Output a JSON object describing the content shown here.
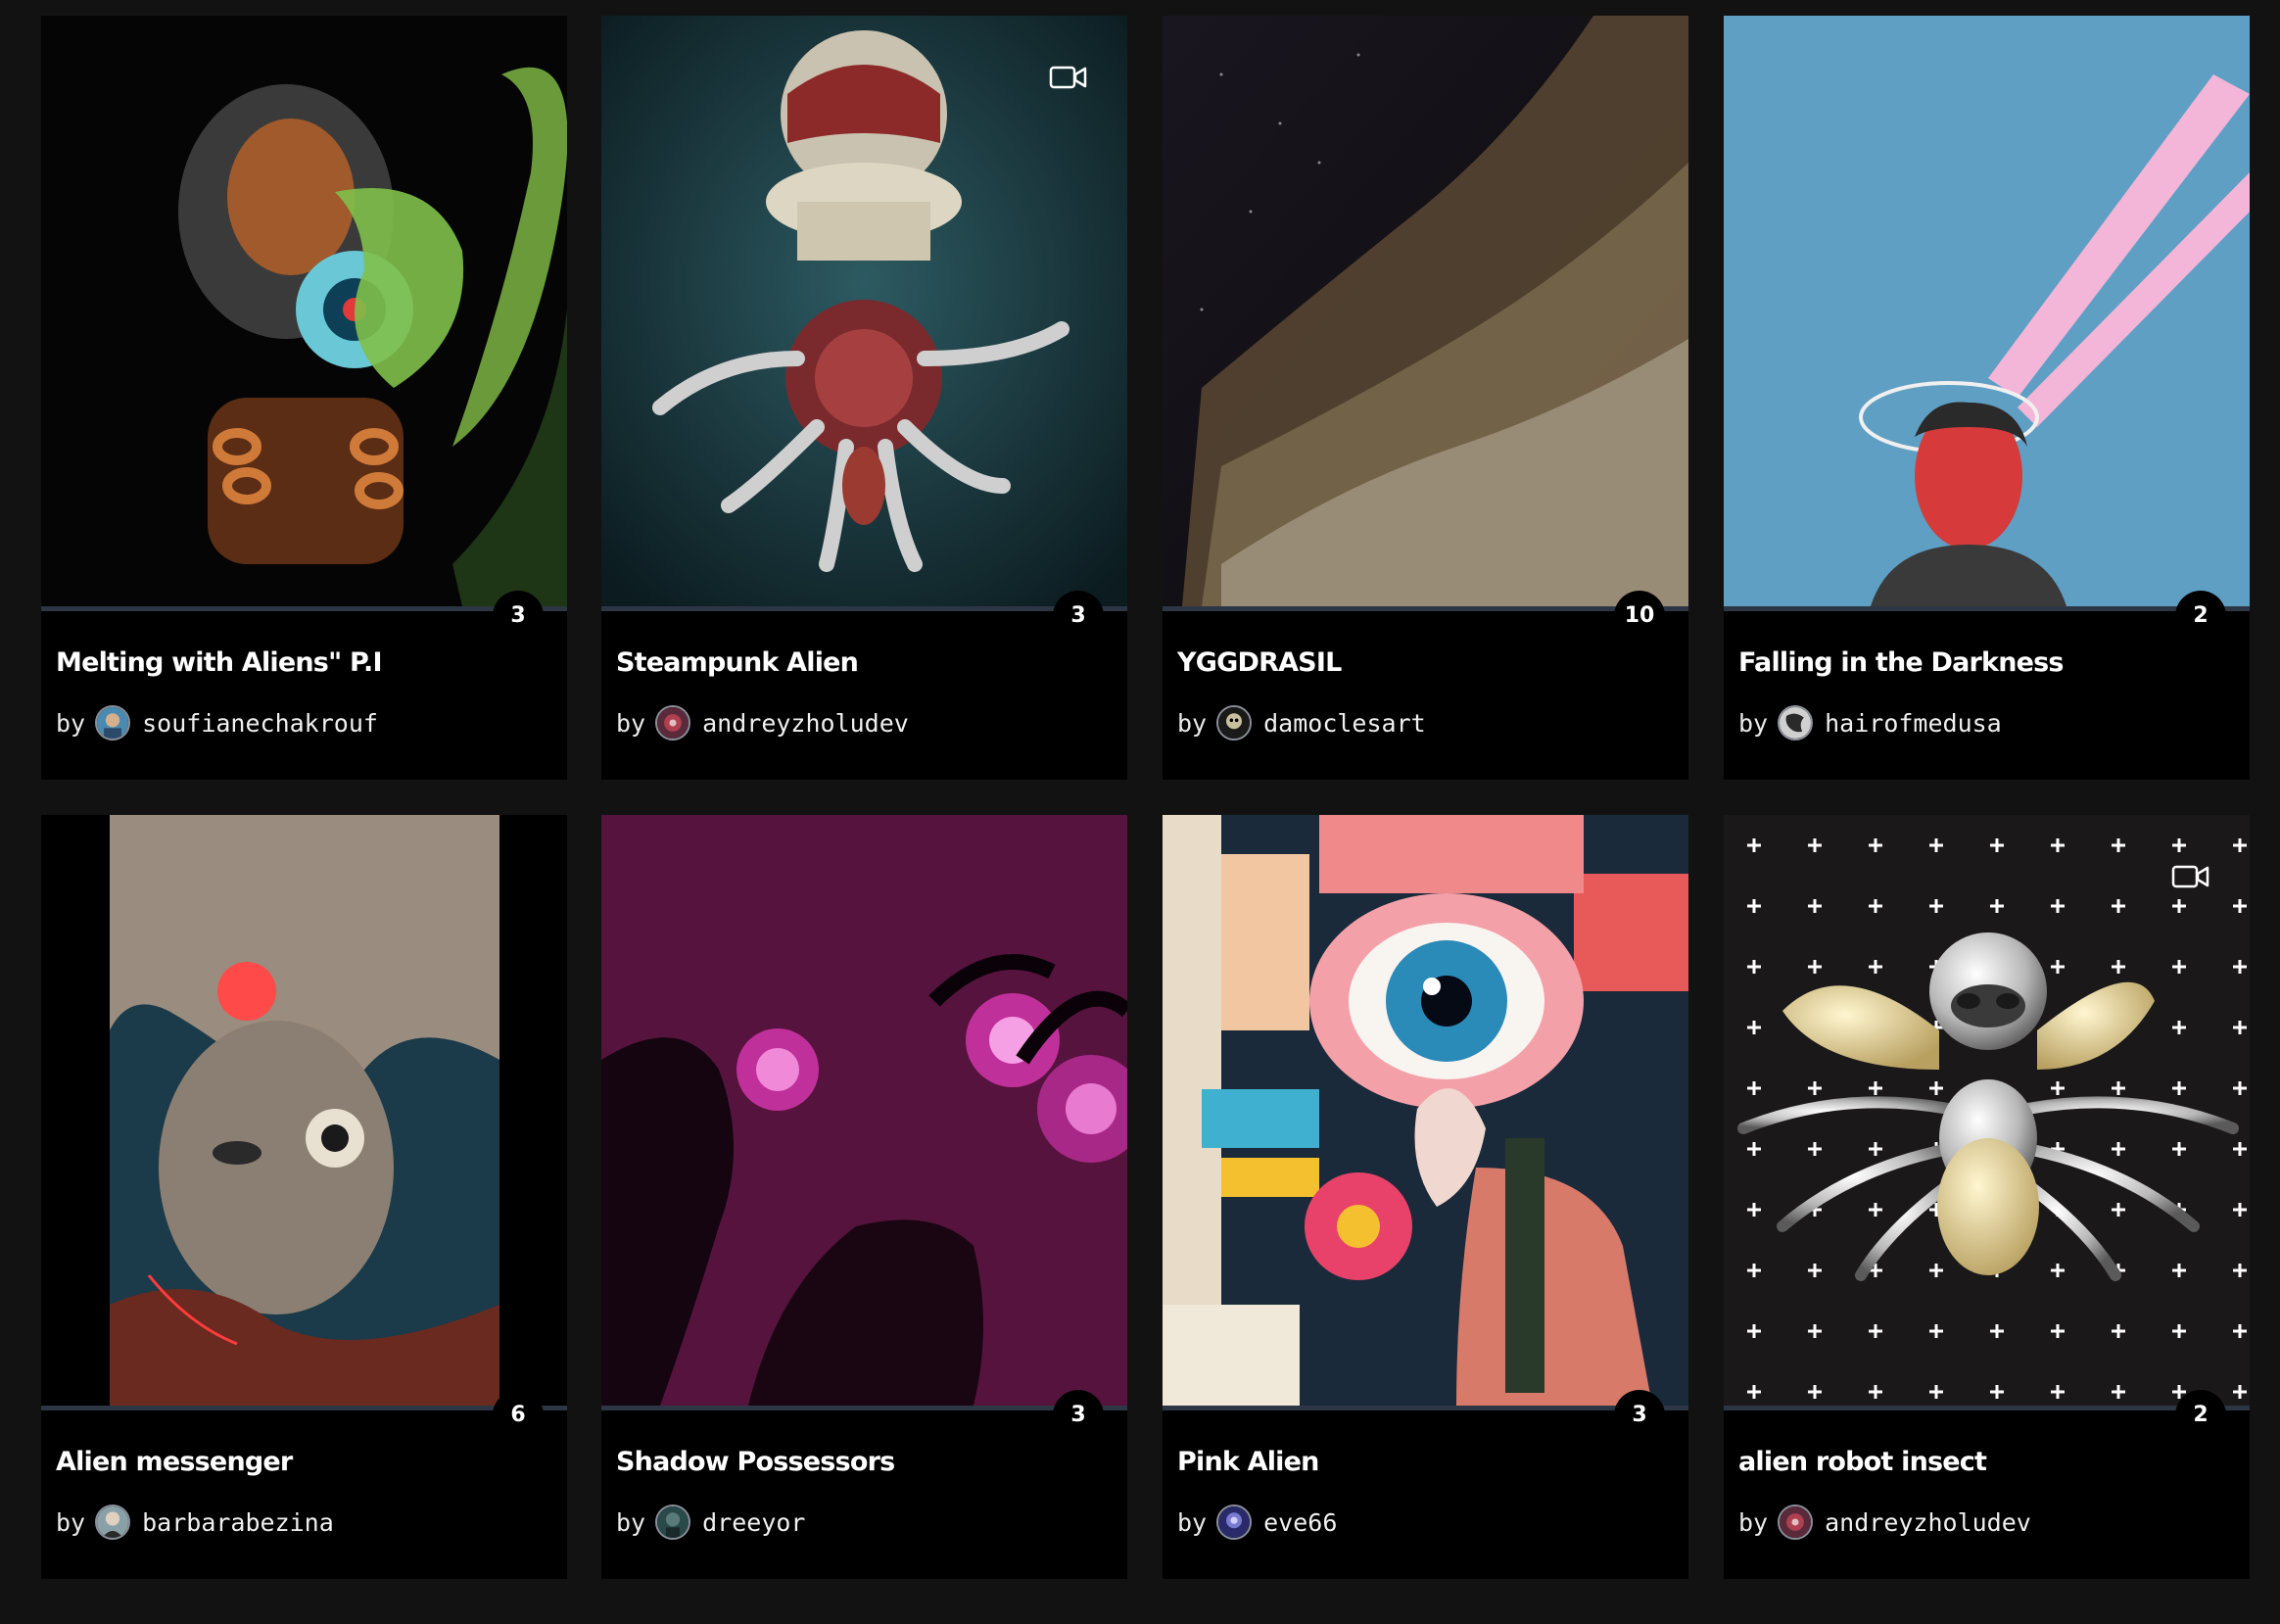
{
  "cards": [
    {
      "title": "Melting with Aliens\" P.I",
      "by": "by",
      "author": "soufianechakrouf",
      "count": "3"
    },
    {
      "title": "Steampunk Alien",
      "by": "by",
      "author": "andreyzholudev",
      "count": "3"
    },
    {
      "title": "YGGDRASIL",
      "by": "by",
      "author": "damoclesart",
      "count": "10"
    },
    {
      "title": "Falling in the Darkness",
      "by": "by",
      "author": "hairofmedusa",
      "count": "2"
    },
    {
      "title": "Alien messenger",
      "by": "by",
      "author": "barbarabezina",
      "count": "6"
    },
    {
      "title": "Shadow Possessors",
      "by": "by",
      "author": "dreeyor",
      "count": "3"
    },
    {
      "title": "Pink Alien",
      "by": "by",
      "author": "eve66",
      "count": "3"
    },
    {
      "title": "alien robot insect",
      "by": "by",
      "author": "andreyzholudev",
      "count": "2"
    }
  ],
  "colors": {
    "page_background": "#121212",
    "card_background": "#000000",
    "progress_bar": "#2c3644",
    "text": "#ffffff"
  },
  "icons": {
    "video": "video-camera-icon"
  }
}
